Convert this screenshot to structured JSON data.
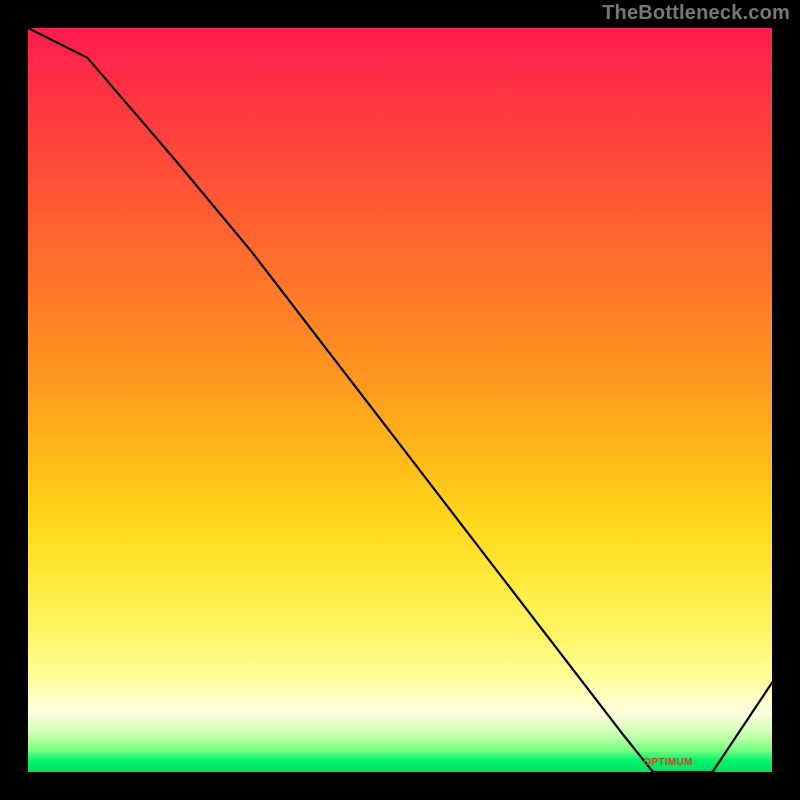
{
  "watermark": "TheBottleneck.com",
  "chart_data": {
    "type": "line",
    "title": "",
    "xlabel": "",
    "ylabel": "",
    "xlim": [
      0,
      100
    ],
    "ylim": [
      0,
      100
    ],
    "series": [
      {
        "name": "curve",
        "x": [
          0,
          8,
          20,
          30,
          40,
          50,
          60,
          70,
          80,
          84,
          92,
          100
        ],
        "values": [
          100,
          96,
          82,
          70,
          57,
          44,
          31,
          18,
          5,
          0,
          0,
          12
        ]
      }
    ],
    "annotations": [
      {
        "text": "OPTIMUM",
        "x": 86,
        "y": 1
      }
    ],
    "grid": false,
    "legend": false
  }
}
